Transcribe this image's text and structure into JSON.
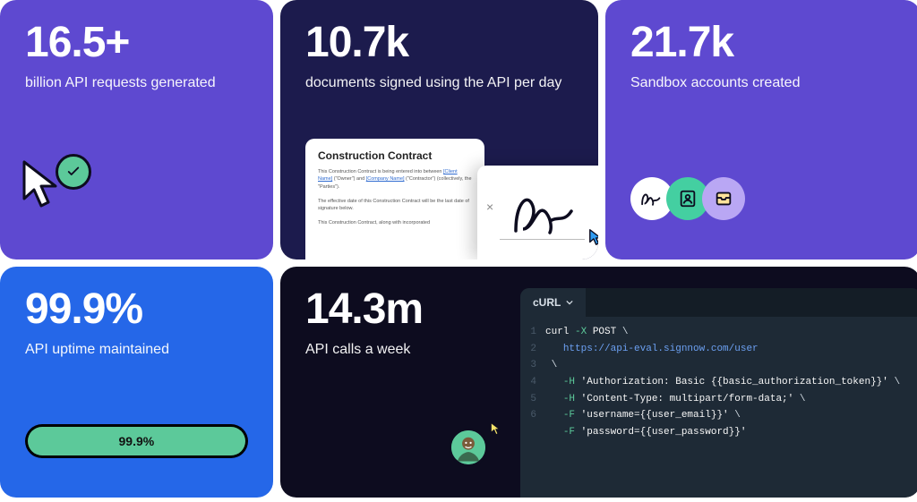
{
  "cards": {
    "api_requests": {
      "value": "16.5+",
      "label": "billion API requests generated"
    },
    "documents_signed": {
      "value": "10.7k",
      "label": "documents signed using the API per day",
      "doc_title": "Construction Contract",
      "doc_para1_a": "This Construction Contract is being entered into between ",
      "doc_para1_client": "[Client Name]",
      "doc_para1_b": " (\"Owner\") and ",
      "doc_para1_company": "[Company Name]",
      "doc_para1_c": " (\"Contractor\") (collectively, the \"Parties\").",
      "doc_para2": "The effective date of this Construction Contract will be the last date of signature below.",
      "doc_para3": "This Construction Contract, along with incorporated"
    },
    "sandbox": {
      "value": "21.7k",
      "label": "Sandbox accounts created"
    },
    "uptime": {
      "value": "99.9%",
      "label": "API uptime maintained",
      "bar_label": "99.9%"
    },
    "api_calls": {
      "value": "14.3m",
      "label": "API calls a week",
      "code_tab": "cURL",
      "code_lines": [
        {
          "n": "1",
          "tokens": [
            [
              "tk-cmd",
              "curl "
            ],
            [
              "tk-flag",
              "-X"
            ],
            [
              "tk-cmd",
              " POST "
            ],
            [
              "tk-punct",
              "\\"
            ]
          ]
        },
        {
          "n": "2",
          "tokens": [
            [
              "tk-cmd",
              "   "
            ],
            [
              "tk-url",
              "https://api-eval.signnow.com/user"
            ]
          ]
        },
        {
          "n": "3",
          "tokens": [
            [
              "tk-punct",
              " \\"
            ]
          ]
        },
        {
          "n": "4",
          "tokens": [
            [
              "tk-cmd",
              "   "
            ],
            [
              "tk-flag",
              "-H"
            ],
            [
              "tk-str",
              " 'Authorization: Basic {{basic_authorization_token}}' "
            ],
            [
              "tk-punct",
              "\\"
            ]
          ]
        },
        {
          "n": "5",
          "tokens": [
            [
              "tk-cmd",
              "   "
            ],
            [
              "tk-flag",
              "-H"
            ],
            [
              "tk-str",
              " 'Content-Type: multipart/form-data;' "
            ],
            [
              "tk-punct",
              "\\"
            ]
          ]
        },
        {
          "n": "6",
          "tokens": [
            [
              "tk-cmd",
              "   "
            ],
            [
              "tk-flag",
              "-F"
            ],
            [
              "tk-str",
              " 'username={{user_email}}' "
            ],
            [
              "tk-punct",
              "\\"
            ]
          ]
        },
        {
          "n": "",
          "tokens": [
            [
              "tk-cmd",
              "   "
            ],
            [
              "tk-flag",
              "-F"
            ],
            [
              "tk-str",
              " 'password={{user_password}}'"
            ]
          ]
        }
      ]
    }
  }
}
